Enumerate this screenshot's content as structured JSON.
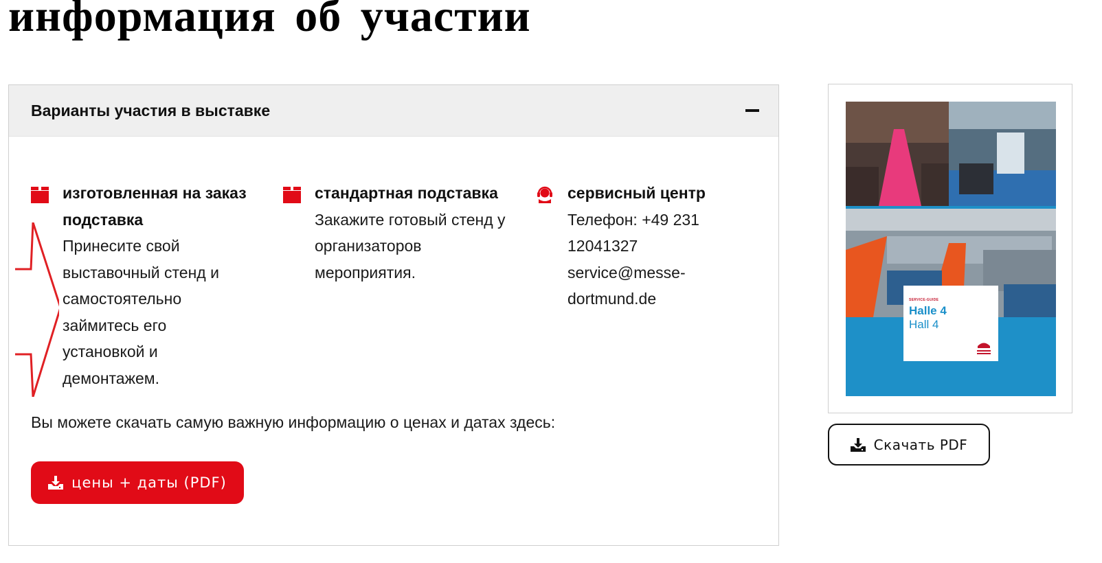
{
  "heading": "информация об участии",
  "accordion": {
    "title": "Варианты участия в выставке",
    "toggle_icon": "minus-icon",
    "options": [
      {
        "icon": "box-icon",
        "title": "изготовленная на заказ подставка",
        "description": "Принесите свой выставочный стенд и самостоятельно займитесь его установкой и демонтажем."
      },
      {
        "icon": "box-icon",
        "title": "стандартная подставка",
        "description": "Закажите готовый стенд у организаторов мероприятия."
      },
      {
        "icon": "headset-icon",
        "title": "сервисный центр",
        "phone": "Телефон: +49 231 12041327",
        "email": "service@messe-dortmund.de"
      }
    ],
    "info_text": "Вы можете скачать самую важную информацию о ценах и датах здесь:",
    "download_button": {
      "icon": "download-icon",
      "label": "цены + даты (PDF)"
    }
  },
  "brochure": {
    "card_small": "SERVICE-GUIDE",
    "card_line1": "Halle 4",
    "card_line2": "Hall 4",
    "download_button": {
      "icon": "download-icon",
      "label": "Скачать PDF"
    }
  },
  "colors": {
    "accent": "#e10b17",
    "header_bg": "#efefef",
    "border": "#cfcfcf",
    "brochure_blue": "#1a8fc9"
  }
}
